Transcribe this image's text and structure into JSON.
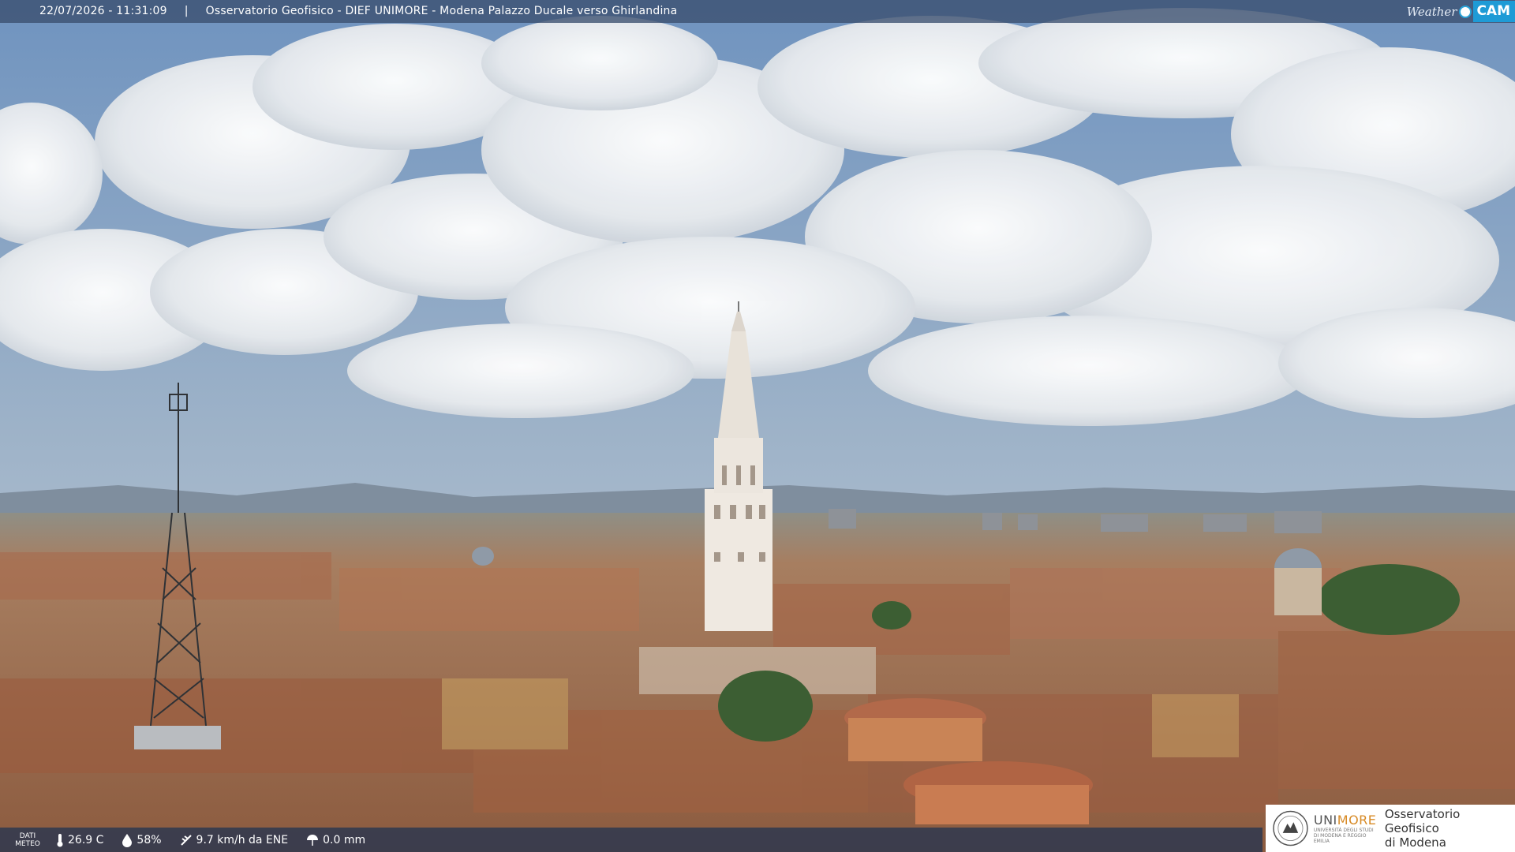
{
  "header": {
    "timestamp": "22/07/2026 - 11:31:09",
    "separator": "|",
    "camera_title": "Osservatorio Geofisico - DIEF UNIMORE - Modena Palazzo Ducale verso Ghirlandina"
  },
  "brand": {
    "weather": "Weather",
    "cam": "CAM"
  },
  "meteo": {
    "label_line1": "DATI",
    "label_line2": "METEO",
    "temperature": "26.9 C",
    "humidity": "58%",
    "wind": "9.7 km/h da ENE",
    "rain": "0.0 mm"
  },
  "logo": {
    "uni_prefix": "UNI",
    "uni_suffix": "MORE",
    "uni_sub": "UNIVERSITÀ DEGLI STUDI DI MODENA E REGGIO EMILIA",
    "obs_line1": "Osservatorio Geofisico",
    "obs_line2": "di Modena"
  },
  "colors": {
    "bar": "#3a4e6e",
    "accent": "#1e9bd6",
    "unimore_orange": "#d78a25",
    "roof": "#b06a45",
    "sky": "#7a9dc4"
  }
}
